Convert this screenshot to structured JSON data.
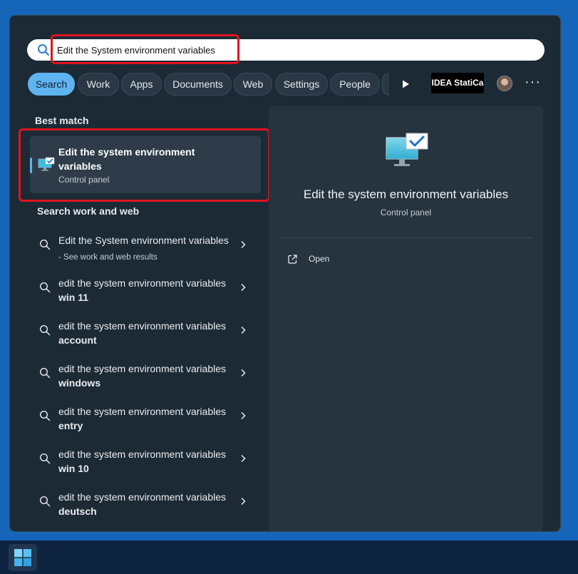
{
  "search": {
    "value": "Edit the System environment variables"
  },
  "tabs": [
    {
      "label": "Search",
      "active": true
    },
    {
      "label": "Work",
      "active": false
    },
    {
      "label": "Apps",
      "active": false
    },
    {
      "label": "Documents",
      "active": false
    },
    {
      "label": "Web",
      "active": false
    },
    {
      "label": "Settings",
      "active": false
    },
    {
      "label": "People",
      "active": false
    }
  ],
  "org_badge": "IDEA StatiCa",
  "more_label": "···",
  "best_match": {
    "heading": "Best match",
    "title": "Edit the system environment variables",
    "subtitle": "Control panel",
    "icon": "monitor-check-icon"
  },
  "work_web": {
    "heading": "Search work and web",
    "results": [
      {
        "normal": "Edit the System environment variables",
        "bold": "",
        "suffix": " - See work and web results"
      },
      {
        "normal": "edit the system environment variables ",
        "bold": "win 11",
        "suffix": ""
      },
      {
        "normal": "edit the system environment variables ",
        "bold": "account",
        "suffix": ""
      },
      {
        "normal": "edit the system environment variables ",
        "bold": "windows",
        "suffix": ""
      },
      {
        "normal": "edit the system environment variables ",
        "bold": "entry",
        "suffix": ""
      },
      {
        "normal": "edit the system environment variables ",
        "bold": "win 10",
        "suffix": ""
      },
      {
        "normal": "edit the system environment variables ",
        "bold": "deutsch",
        "suffix": ""
      }
    ]
  },
  "preview": {
    "title": "Edit the system environment variables",
    "subtitle": "Control panel",
    "actions": [
      {
        "label": "Open",
        "icon": "open-external-icon"
      }
    ]
  },
  "colors": {
    "accent": "#5fb4f0",
    "highlight": "#e0141c",
    "panel": "#1c2a36"
  }
}
